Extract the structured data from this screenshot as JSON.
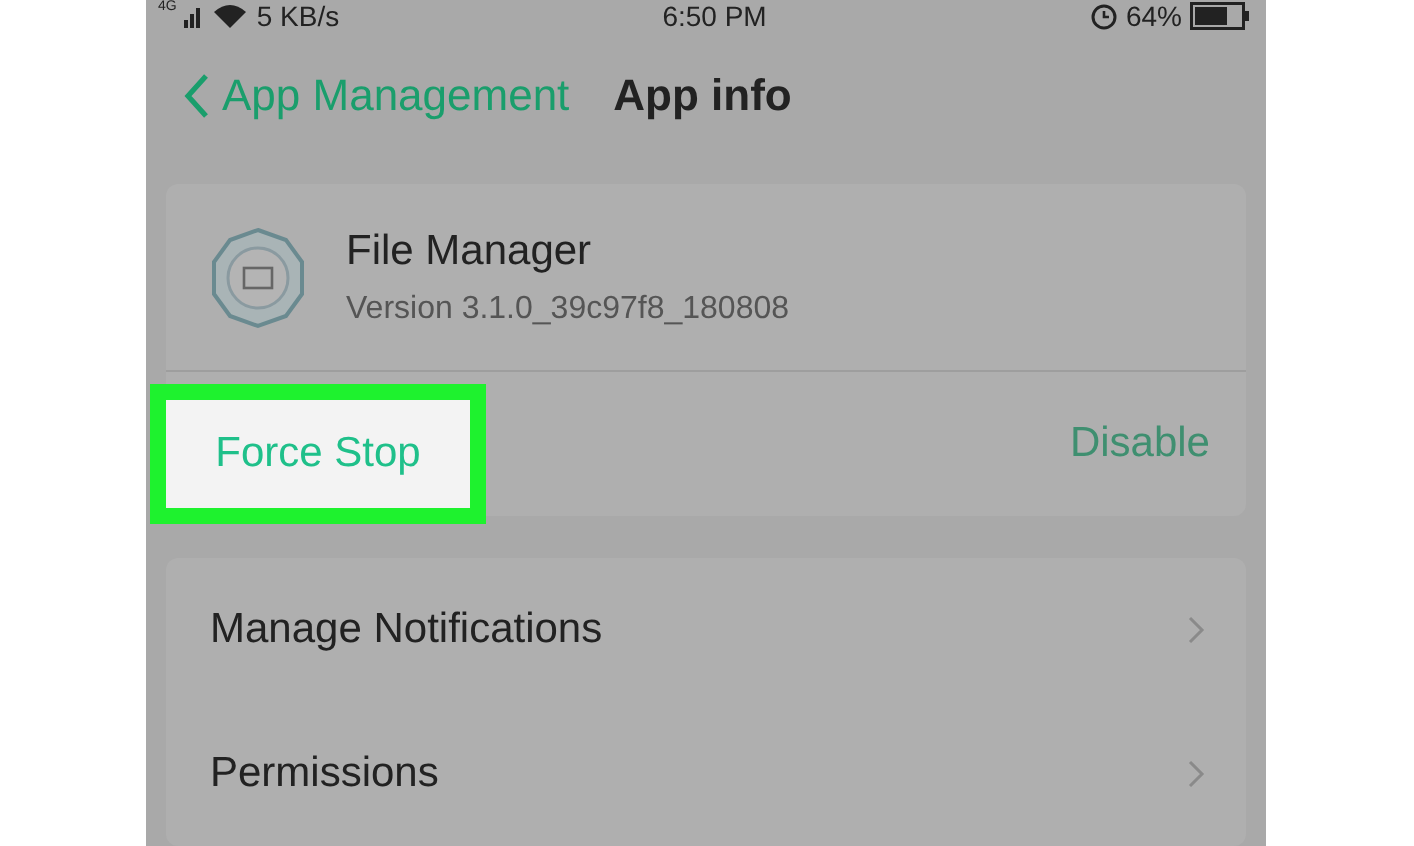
{
  "status_bar": {
    "network": "4G",
    "speed": "5 KB/s",
    "time": "6:50 PM",
    "battery": "64%"
  },
  "header": {
    "back_label": "App Management",
    "title": "App info"
  },
  "app": {
    "name": "File Manager",
    "version": "Version 3.1.0_39c97f8_180808"
  },
  "actions": [
    {
      "label": "Force Stop",
      "disabled": false,
      "highlighted": true
    },
    {
      "label": "Disable",
      "disabled": true,
      "highlighted": false
    }
  ],
  "settings": [
    {
      "label": "Manage Notifications"
    },
    {
      "label": "Permissions"
    }
  ]
}
